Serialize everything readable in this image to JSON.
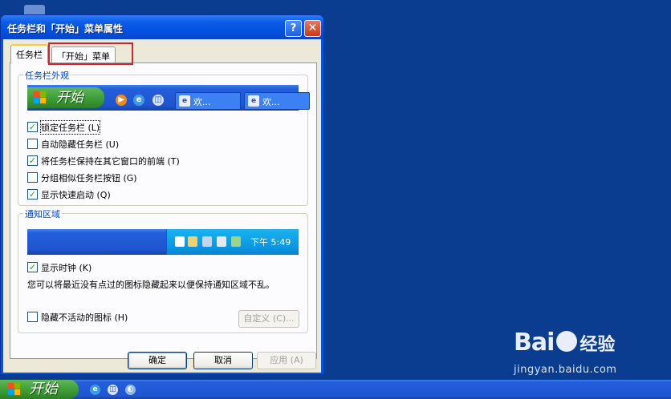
{
  "window": {
    "title": "任务栏和「开始」菜单属性",
    "help_glyph": "?",
    "close_glyph": "✕"
  },
  "tabs": [
    {
      "label": "任务栏",
      "active": true
    },
    {
      "label": "「开始」菜单",
      "active": false,
      "highlighted": true
    }
  ],
  "appearance": {
    "group_title": "任务栏外观",
    "preview": {
      "start_label": "开始",
      "buttons": [
        "欢...",
        "欢..."
      ]
    },
    "options": [
      {
        "label": "锁定任务栏 (L)",
        "checked": true,
        "focused": true
      },
      {
        "label": "自动隐藏任务栏 (U)",
        "checked": false
      },
      {
        "label": "将任务栏保持在其它窗口的前端 (T)",
        "checked": true
      },
      {
        "label": "分组相似任务栏按钮 (G)",
        "checked": false
      },
      {
        "label": "显示快速启动 (Q)",
        "checked": true
      }
    ]
  },
  "notification": {
    "group_title": "通知区域",
    "clock_text": "下午 5:49",
    "show_clock": {
      "label": "显示时钟 (K)",
      "checked": true
    },
    "note": "您可以将最近没有点过的图标隐藏起来以便保持通知区域不乱。",
    "hide_inactive": {
      "label": "隐藏不活动的图标 (H)",
      "checked": false
    },
    "customize_label": "自定义 (C)..."
  },
  "buttons": {
    "ok": "确定",
    "cancel": "取消",
    "apply": "应用 (A)"
  },
  "taskbar": {
    "start_label": "开始"
  },
  "watermark": {
    "logo_left": "Bai",
    "logo_right": "经验",
    "url": "jingyan.baidu.com"
  },
  "colors": {
    "desktop": "#0a3c90",
    "title_bar": "#0350e0",
    "dialog_bg": "#ece9d8",
    "start_green": "#3a9b32",
    "highlight_box": "#d8232a"
  }
}
